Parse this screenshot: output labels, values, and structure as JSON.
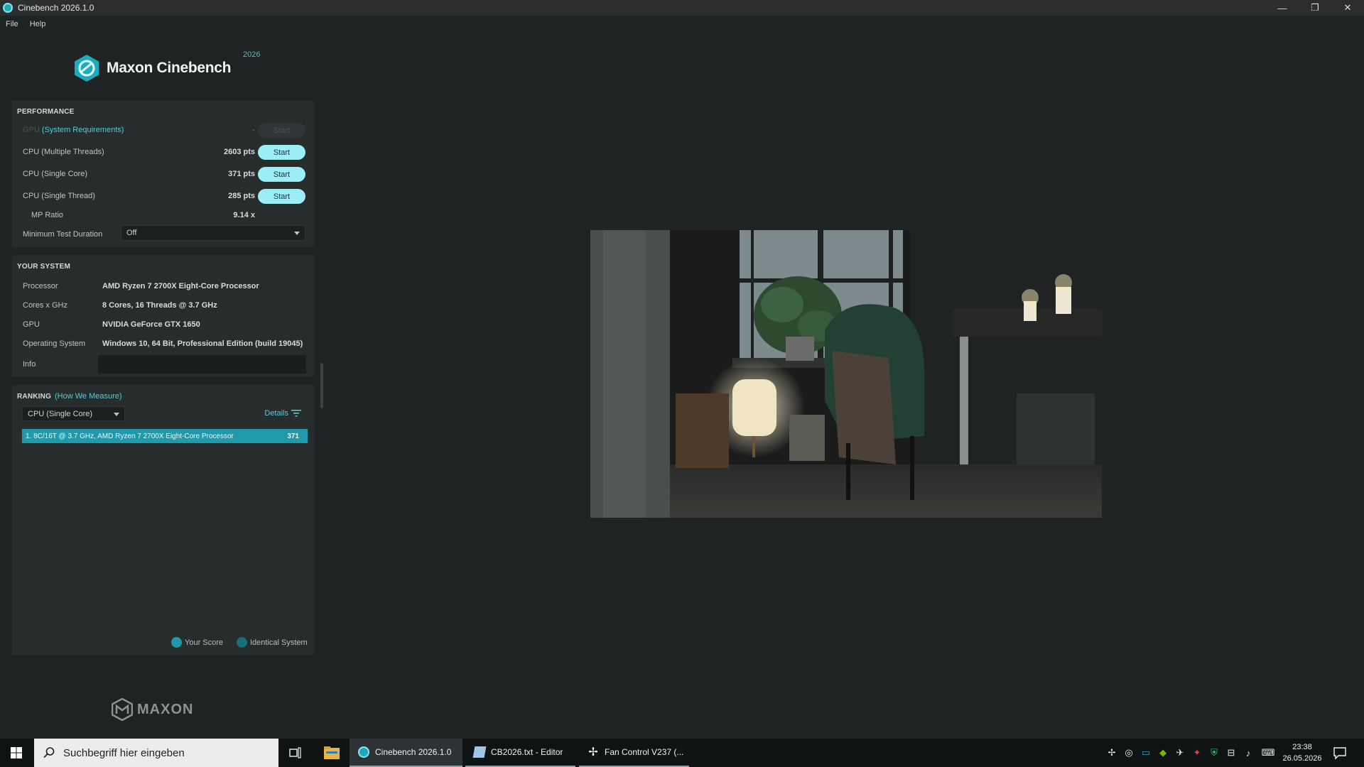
{
  "window": {
    "title": "Cinebench 2026.1.0",
    "controls": [
      "—",
      "❐",
      "✕"
    ]
  },
  "menu": [
    "File",
    "Help"
  ],
  "logo": {
    "name": "Maxon Cinebench",
    "year": "2026"
  },
  "performance": {
    "title": "PERFORMANCE",
    "gpu_label": "GPU",
    "gpu_link": "(System Requirements)",
    "gpu_score": "-",
    "start_label": "Start",
    "tests": [
      {
        "label": "CPU (Multiple Threads)",
        "score": "2603 pts"
      },
      {
        "label": "CPU (Single Core)",
        "score": "371 pts"
      },
      {
        "label": "CPU (Single Thread)",
        "score": "285 pts"
      }
    ],
    "mp_ratio_label": "MP Ratio",
    "mp_ratio_value": "9.14 x",
    "min_duration_label": "Minimum Test Duration",
    "min_duration_value": "Off"
  },
  "system": {
    "title": "YOUR SYSTEM",
    "rows": [
      {
        "label": "Processor",
        "value": "AMD Ryzen 7 2700X Eight-Core Processor"
      },
      {
        "label": "Cores x GHz",
        "value": "8 Cores, 16 Threads @ 3.7 GHz"
      },
      {
        "label": "GPU",
        "value": "NVIDIA GeForce GTX 1650"
      },
      {
        "label": "Operating System",
        "value": "Windows 10, 64 Bit, Professional Edition (build 19045)"
      }
    ],
    "info_label": "Info",
    "info_value": ""
  },
  "ranking": {
    "title": "RANKING",
    "link": "(How We Measure)",
    "select_value": "CPU (Single Core)",
    "details_label": "Details",
    "entries": [
      {
        "text": "1. 8C/16T @ 3.7 GHz, AMD Ryzen 7 2700X Eight-Core Processor",
        "score": "371"
      }
    ],
    "legend": [
      {
        "label": "Your Score",
        "color": "#1e9aaa"
      },
      {
        "label": "Identical System",
        "color": "#17707c"
      }
    ]
  },
  "footer_logo": "MAXON",
  "taskbar": {
    "search_placeholder": "Suchbegriff hier eingeben",
    "apps": [
      {
        "label": "Cinebench 2026.1.0"
      },
      {
        "label": "CB2026.txt - Editor"
      },
      {
        "label": "Fan Control V237 (..."
      }
    ],
    "time": "23:38",
    "date": "26.05.2026"
  },
  "colors": {
    "accent": "#1e9aaa",
    "button": "#9beef6",
    "link": "#52cfdc",
    "background": "#1f2324",
    "panel": "#272c2d"
  }
}
